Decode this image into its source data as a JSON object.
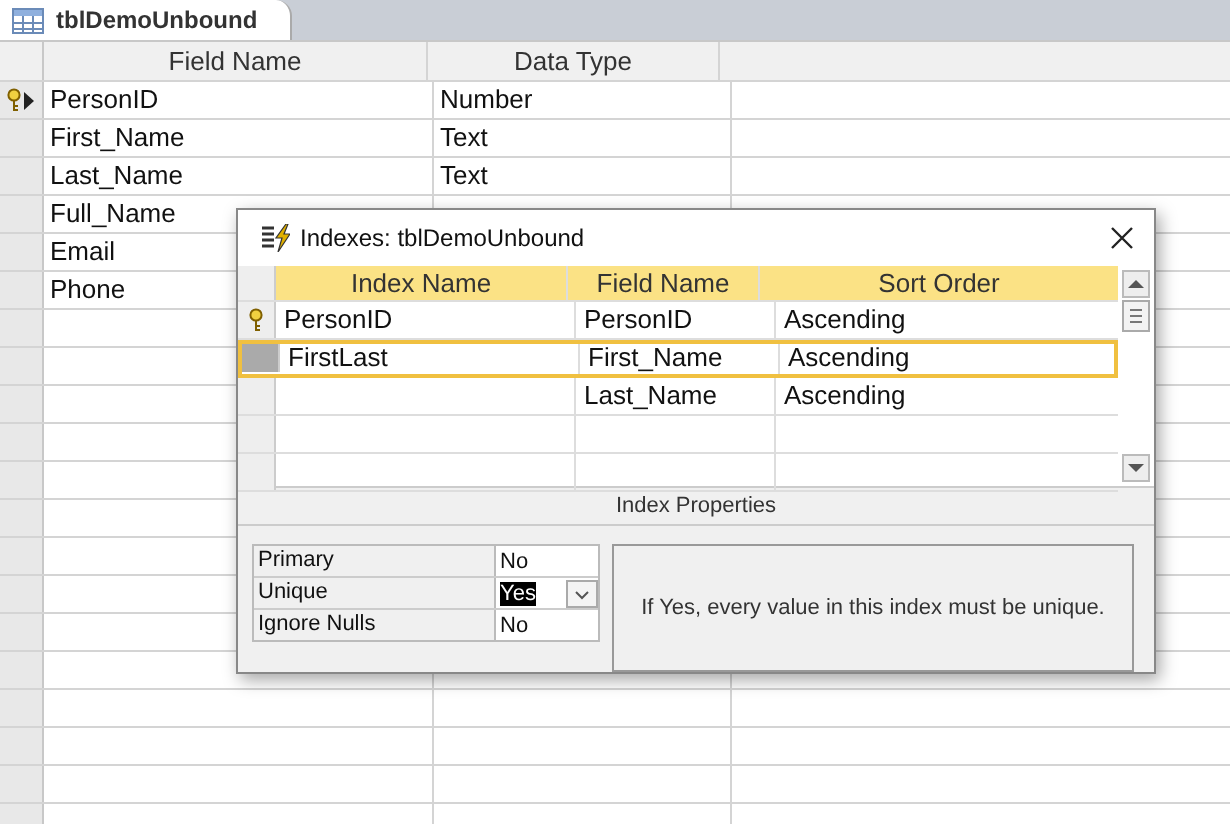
{
  "document_tab": {
    "title": "tblDemoUnbound"
  },
  "design_grid": {
    "columns": [
      "Field Name",
      "Data Type"
    ],
    "rows": [
      {
        "field_name": "PersonID",
        "data_type": "Number",
        "primary_key": true,
        "selected": true
      },
      {
        "field_name": "First_Name",
        "data_type": "Text",
        "primary_key": false,
        "selected": false
      },
      {
        "field_name": "Last_Name",
        "data_type": "Text",
        "primary_key": false,
        "selected": false
      },
      {
        "field_name": "Full_Name",
        "primary_key": false,
        "selected": false
      },
      {
        "field_name": "Email",
        "primary_key": false,
        "selected": false
      },
      {
        "field_name": "Phone",
        "primary_key": false,
        "selected": false
      }
    ]
  },
  "indexes_dialog": {
    "title": "Indexes: tblDemoUnbound",
    "columns": [
      "Index Name",
      "Field Name",
      "Sort Order"
    ],
    "rows": [
      {
        "index_name": "PersonID",
        "field_name": "PersonID",
        "sort_order": "Ascending",
        "primary_key": true,
        "selected": false
      },
      {
        "index_name": "FirstLast",
        "field_name": "First_Name",
        "sort_order": "Ascending",
        "primary_key": false,
        "selected": true
      },
      {
        "field_name": "Last_Name",
        "sort_order": "Ascending",
        "primary_key": false,
        "selected": false
      }
    ],
    "properties_heading": "Index Properties",
    "properties": [
      {
        "label": "Primary",
        "value": "No",
        "focused": false
      },
      {
        "label": "Unique",
        "value": "Yes",
        "focused": true
      },
      {
        "label": "Ignore Nulls",
        "value": "No",
        "focused": false
      }
    ],
    "help_text": "If Yes, every value in this index must be unique."
  }
}
